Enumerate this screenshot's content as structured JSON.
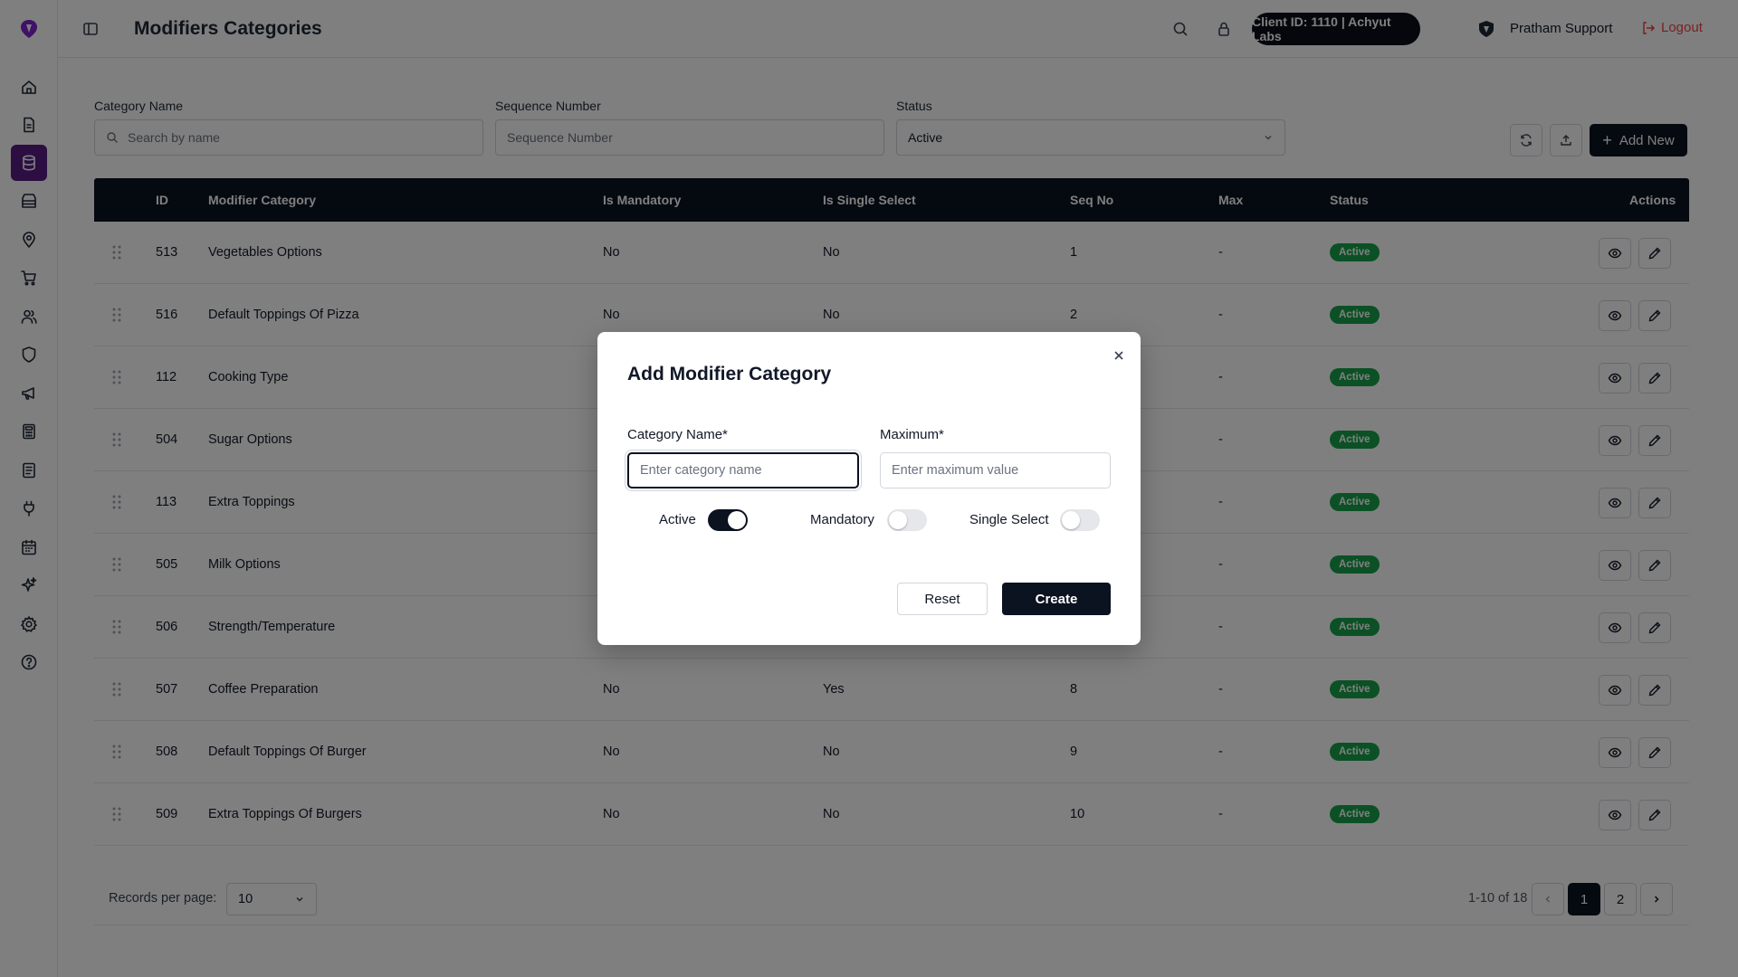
{
  "header": {
    "title": "Modifiers Categories",
    "client_pill": "Client ID: 1110 | Achyut Labs",
    "user_name": "Pratham Support",
    "logout_label": "Logout"
  },
  "sidebar": {
    "icons": [
      "home-icon",
      "document-icon",
      "database-icon",
      "store-icon",
      "location-pin-icon",
      "cart-icon",
      "users-icon",
      "shield-icon",
      "megaphone-icon",
      "calculator-icon",
      "report-icon",
      "plug-icon",
      "calendar-icon",
      "sparkle-icon",
      "settings-icon",
      "help-icon"
    ],
    "active_icon": "database-icon"
  },
  "filters": {
    "category_name_label": "Category Name",
    "category_name_placeholder": "Search by name",
    "sequence_label": "Sequence Number",
    "sequence_placeholder": "Sequence Number",
    "status_label": "Status",
    "status_value": "Active",
    "add_new_label": "Add New"
  },
  "table": {
    "headers": [
      "ID",
      "Modifier Category",
      "Is Mandatory",
      "Is Single Select",
      "Seq No",
      "Max",
      "Status",
      "Actions"
    ],
    "rows": [
      {
        "id": "513",
        "name": "Vegetables Options",
        "mandatory": "No",
        "single": "No",
        "seq": "1",
        "max": "-",
        "status": "Active"
      },
      {
        "id": "516",
        "name": "Default Toppings Of Pizza",
        "mandatory": "No",
        "single": "No",
        "seq": "2",
        "max": "-",
        "status": "Active"
      },
      {
        "id": "112",
        "name": "Cooking Type",
        "mandatory": "",
        "single": "",
        "seq": "",
        "max": "-",
        "status": "Active"
      },
      {
        "id": "504",
        "name": "Sugar Options",
        "mandatory": "",
        "single": "",
        "seq": "",
        "max": "-",
        "status": "Active"
      },
      {
        "id": "113",
        "name": "Extra Toppings",
        "mandatory": "",
        "single": "",
        "seq": "",
        "max": "-",
        "status": "Active"
      },
      {
        "id": "505",
        "name": "Milk Options",
        "mandatory": "",
        "single": "",
        "seq": "",
        "max": "-",
        "status": "Active"
      },
      {
        "id": "506",
        "name": "Strength/Temperature",
        "mandatory": "",
        "single": "",
        "seq": "",
        "max": "-",
        "status": "Active"
      },
      {
        "id": "507",
        "name": "Coffee Preparation",
        "mandatory": "No",
        "single": "Yes",
        "seq": "8",
        "max": "-",
        "status": "Active"
      },
      {
        "id": "508",
        "name": "Default Toppings Of Burger",
        "mandatory": "No",
        "single": "No",
        "seq": "9",
        "max": "-",
        "status": "Active"
      },
      {
        "id": "509",
        "name": "Extra Toppings Of Burgers",
        "mandatory": "No",
        "single": "No",
        "seq": "10",
        "max": "-",
        "status": "Active"
      }
    ]
  },
  "pagination": {
    "records_label": "Records per page:",
    "records_value": "10",
    "range": "1-10 of 18",
    "pages": [
      "1",
      "2"
    ],
    "current_page": "1"
  },
  "modal": {
    "title": "Add Modifier Category",
    "category_label": "Category Name*",
    "category_placeholder": "Enter category name",
    "maximum_label": "Maximum*",
    "maximum_placeholder": "Enter maximum value",
    "active_label": "Active",
    "active_on": true,
    "mandatory_label": "Mandatory",
    "mandatory_on": false,
    "single_select_label": "Single Select",
    "single_select_on": false,
    "reset_label": "Reset",
    "create_label": "Create"
  }
}
